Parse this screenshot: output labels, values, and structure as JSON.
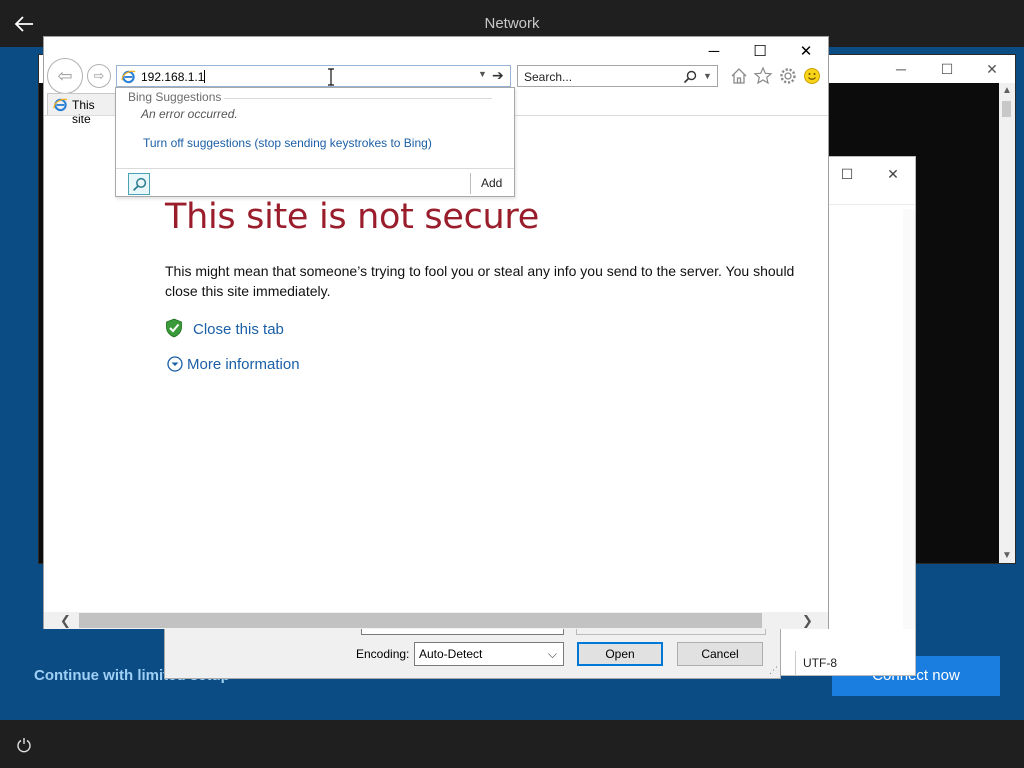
{
  "oobe": {
    "title": "Network",
    "limited_setup": "Continue with limited setup",
    "connect_now": "Connect now",
    "icons": {
      "back": "back-arrow-icon",
      "power": "power-icon"
    }
  },
  "file_dialog": {
    "encoding_label": "Encoding:",
    "encoding_value": "Auto-Detect",
    "open_button": "Open",
    "cancel_button": "Cancel",
    "status_encoding": "UTF-8"
  },
  "browser": {
    "address_value": "192.168.1.1",
    "search_placeholder": "Search...",
    "tab_label": "This site",
    "caption": {
      "minimize": "─",
      "maximize": "☐",
      "close": "✕"
    },
    "icons": [
      "home-icon",
      "favorites-star-icon",
      "settings-gear-icon",
      "feedback-smiley-icon"
    ]
  },
  "suggestions": {
    "header": "Bing Suggestions",
    "error": "An error occurred.",
    "turn_off": "Turn off suggestions (stop sending keystrokes to Bing)",
    "add": "Add"
  },
  "page": {
    "title": "This site is not secure",
    "desc_line1": "This might mean that someone’s trying to fool you or steal any info you send to the server. You should",
    "desc_line2": "close this site immediately.",
    "close_tab": "Close this tab",
    "more_info": "More information"
  },
  "colors": {
    "oobe_blue": "#0b4c84",
    "error_title": "#9a1d2c",
    "link_blue": "#1a5fa8",
    "connect_blue": "#1a7de0"
  }
}
